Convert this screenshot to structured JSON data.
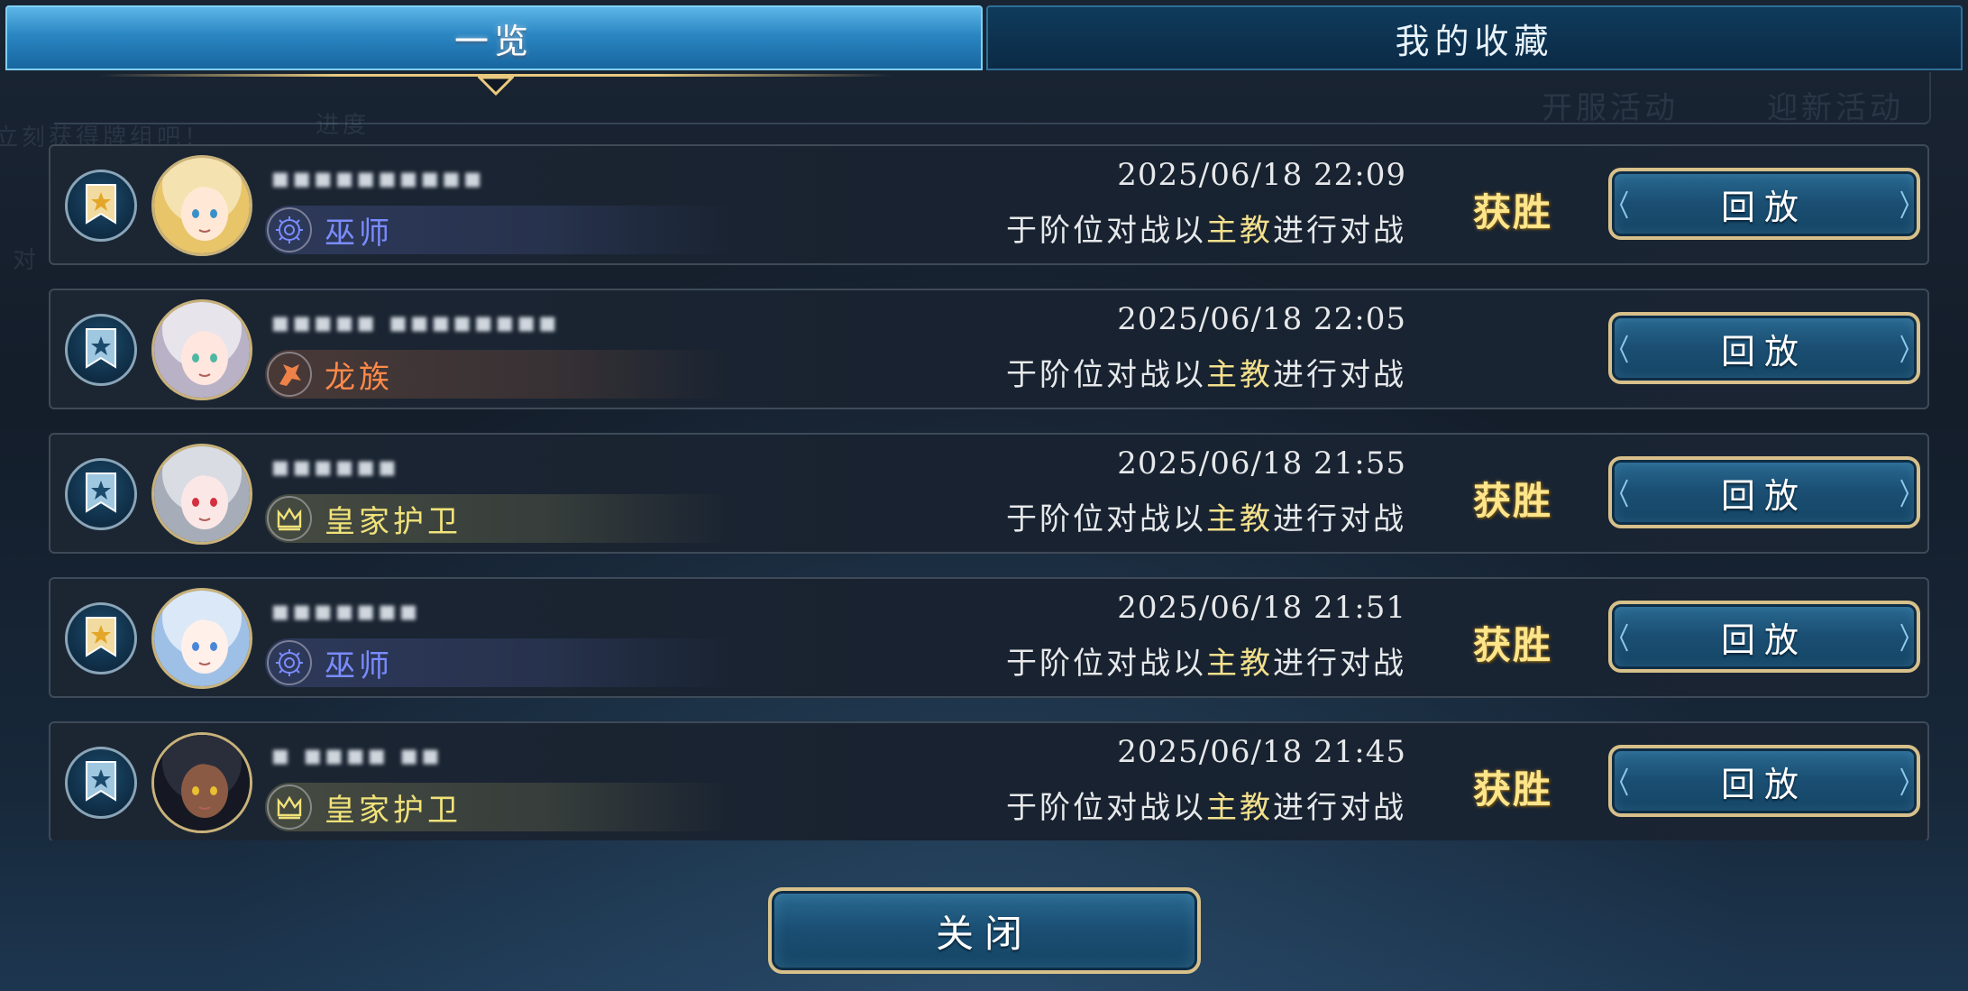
{
  "tabs": {
    "overview": "一览",
    "favorites": "我的收藏"
  },
  "background_text": {
    "event_1": "开服活动",
    "event_2": "迎新活动",
    "hint_1": "立刻获得牌组吧！",
    "hint_2": "进度",
    "hint_3": "对"
  },
  "records": [
    {
      "favorited": true,
      "player_name": "▪▪▪▪▪▪▪▪▪▪",
      "class_name": "巫师",
      "class_icon": "wizard-icon",
      "class_color": "#7a8cff",
      "datetime": "2025/06/18  22:09",
      "desc_prefix": "于阶位对战以",
      "desc_highlight": "主教",
      "desc_suffix": "进行对战",
      "result": "获胜",
      "replay_label": "回放",
      "avatar": "blonde-girl-avatar"
    },
    {
      "favorited": false,
      "player_name": "▪▪▪▪▪ ▪▪▪▪▪▪▪▪",
      "class_name": "龙族",
      "class_icon": "dragon-icon",
      "class_color": "#ff8a4a",
      "datetime": "2025/06/18  22:05",
      "desc_prefix": "于阶位对战以",
      "desc_highlight": "主教",
      "desc_suffix": "进行对战",
      "result": "",
      "replay_label": "回放",
      "avatar": "white-hair-avatar"
    },
    {
      "favorited": false,
      "player_name": "▪▪▪▪▪▪",
      "class_name": "皇家护卫",
      "class_icon": "crown-icon",
      "class_color": "#f0e27a",
      "datetime": "2025/06/18  21:55",
      "desc_prefix": "于阶位对战以",
      "desc_highlight": "主教",
      "desc_suffix": "进行对战",
      "result": "获胜",
      "replay_label": "回放",
      "avatar": "silver-hair-avatar"
    },
    {
      "favorited": true,
      "player_name": "▪▪▪▪▪▪▪",
      "class_name": "巫师",
      "class_icon": "wizard-icon",
      "class_color": "#7a8cff",
      "datetime": "2025/06/18  21:51",
      "desc_prefix": "于阶位对战以",
      "desc_highlight": "主教",
      "desc_suffix": "进行对战",
      "result": "获胜",
      "replay_label": "回放",
      "avatar": "blue-hair-avatar"
    },
    {
      "favorited": false,
      "player_name": "▪ ▪▪▪▪ ▪▪",
      "class_name": "皇家护卫",
      "class_icon": "crown-icon",
      "class_color": "#f0e27a",
      "datetime": "2025/06/18  21:45",
      "desc_prefix": "于阶位对战以",
      "desc_highlight": "主教",
      "desc_suffix": "进行对战",
      "result": "获胜",
      "replay_label": "回放",
      "avatar": "dark-hair-avatar"
    }
  ],
  "close_label": "关闭",
  "colors": {
    "gold": "#d7c08a",
    "win": "#ffe58a",
    "highlight": "#f3e08c",
    "tab_active": "#2a86c2"
  }
}
